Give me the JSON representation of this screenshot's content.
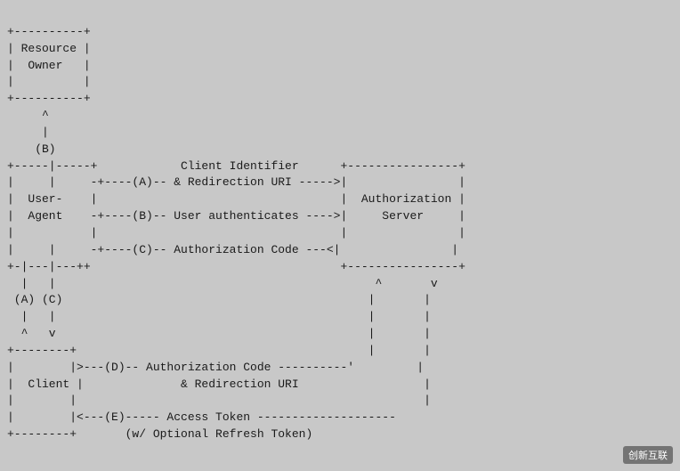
{
  "diagram": {
    "lines": [
      "+----------+",
      "| Resource |",
      "|  Owner   |",
      "|          |",
      "+----------+",
      "     ^",
      "     |",
      "    (B)",
      "+-----|-----+            Client Identifier      +----------------+",
      "|     |     -+----(A)-- & Redirection URI ----->|                |",
      "|  User-    |                                   |  Authorization |",
      "|  Agent    -+----(B)-- User authenticates ---->|     Server     |",
      "|           |                                   |                |",
      "|     |     -+----(C)-- Authorization Code ---<|                |",
      "+-|---|---++                                    +----------------+",
      "  |   |                                              ^       v",
      " (A) (C)                                            |       |",
      "  |   |                                             |       |",
      "  ^   v                                             |       |",
      "+--------+                                          |       |",
      "|        |>---(D)-- Authorization Code ----------'         |",
      "|  Client |              & Redirection URI                  |",
      "|        |                                                  |",
      "|        |<---(E)----- Access Token --------------------",
      "+--------+       (w/ Optional Refresh Token)"
    ],
    "watermark": "创新互联"
  }
}
